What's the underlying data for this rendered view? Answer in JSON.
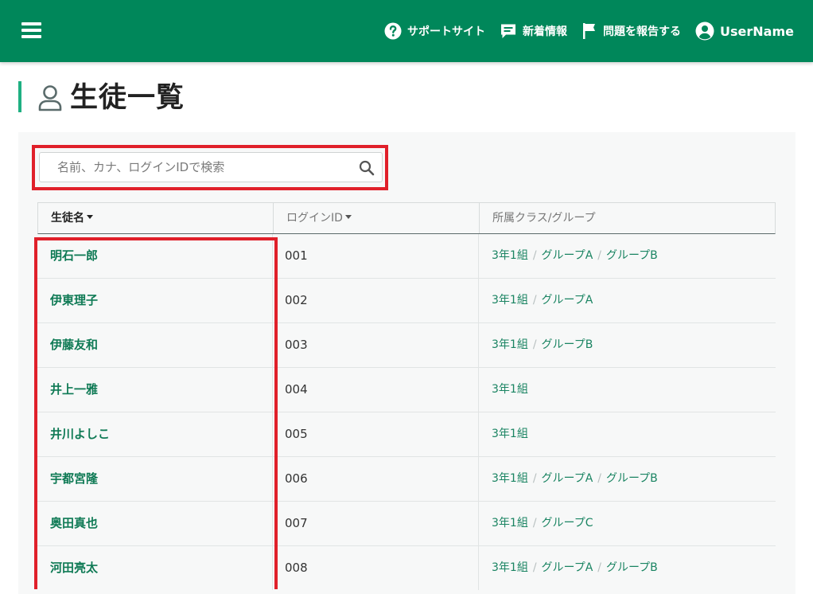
{
  "header": {
    "support_label": "サポートサイト",
    "news_label": "新着情報",
    "report_label": "問題を報告する",
    "username": "UserName"
  },
  "page": {
    "title": "生徒一覧"
  },
  "search": {
    "placeholder": "名前、カナ、ログインIDで検索",
    "value": ""
  },
  "table": {
    "columns": [
      "生徒名",
      "ログインID",
      "所属クラス/グループ"
    ],
    "rows": [
      {
        "name": "明石一郎",
        "login_id": "001",
        "groups": [
          "3年1組",
          "グループA",
          "グループB"
        ]
      },
      {
        "name": "伊東理子",
        "login_id": "002",
        "groups": [
          "3年1組",
          "グループA"
        ]
      },
      {
        "name": "伊藤友和",
        "login_id": "003",
        "groups": [
          "3年1組",
          "グループB"
        ]
      },
      {
        "name": "井上一雅",
        "login_id": "004",
        "groups": [
          "3年1組"
        ]
      },
      {
        "name": "井川よしこ",
        "login_id": "005",
        "groups": [
          "3年1組"
        ]
      },
      {
        "name": "宇都宮隆",
        "login_id": "006",
        "groups": [
          "3年1組",
          "グループA",
          "グループB"
        ]
      },
      {
        "name": "奥田真也",
        "login_id": "007",
        "groups": [
          "3年1組",
          "グループC"
        ]
      },
      {
        "name": "河田亮太",
        "login_id": "008",
        "groups": [
          "3年1組",
          "グループA",
          "グループB"
        ]
      }
    ]
  },
  "colors": {
    "header_bg": "#00875a",
    "accent": "#1fb082",
    "link": "#0f7a55",
    "highlight": "#e0202a"
  },
  "icons": [
    "menu-icon",
    "help-circle-icon",
    "message-icon",
    "flag-icon",
    "user-circle-icon",
    "user-outline-icon",
    "search-icon"
  ]
}
